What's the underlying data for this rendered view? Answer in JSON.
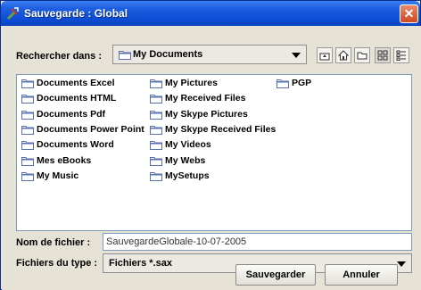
{
  "window": {
    "title": "Sauvegarde : Global",
    "title_icon": "java-cup-icon",
    "close_symbol": "✕"
  },
  "lookin": {
    "label": "Rechercher dans :",
    "value": "My Documents"
  },
  "toolbar": {
    "icons": [
      "up-folder-icon",
      "home-icon",
      "new-folder-icon",
      "list-view-icon",
      "details-view-icon"
    ]
  },
  "files": {
    "columns": [
      [
        "Documents Excel",
        "Documents HTML",
        "Documents Pdf",
        "Documents Power Point",
        "Documents Word",
        "Mes eBooks",
        "My Music"
      ],
      [
        "My Pictures",
        "My Received Files",
        "My Skype Pictures",
        "My Skype Received Files",
        "My Videos",
        "My Webs",
        "MySetups"
      ],
      [
        "PGP"
      ]
    ]
  },
  "filename": {
    "label": "Nom de fichier :",
    "value": "SauvegardeGlobale-10-07-2005"
  },
  "filetype": {
    "label": "Fichiers du type :",
    "value": "Fichiers *.sax"
  },
  "buttons": {
    "save": "Sauvegarder",
    "cancel": "Annuler"
  },
  "colors": {
    "titlebar": "#0c4ed6",
    "close": "#d0471f",
    "folder": "#5a6fb0"
  }
}
